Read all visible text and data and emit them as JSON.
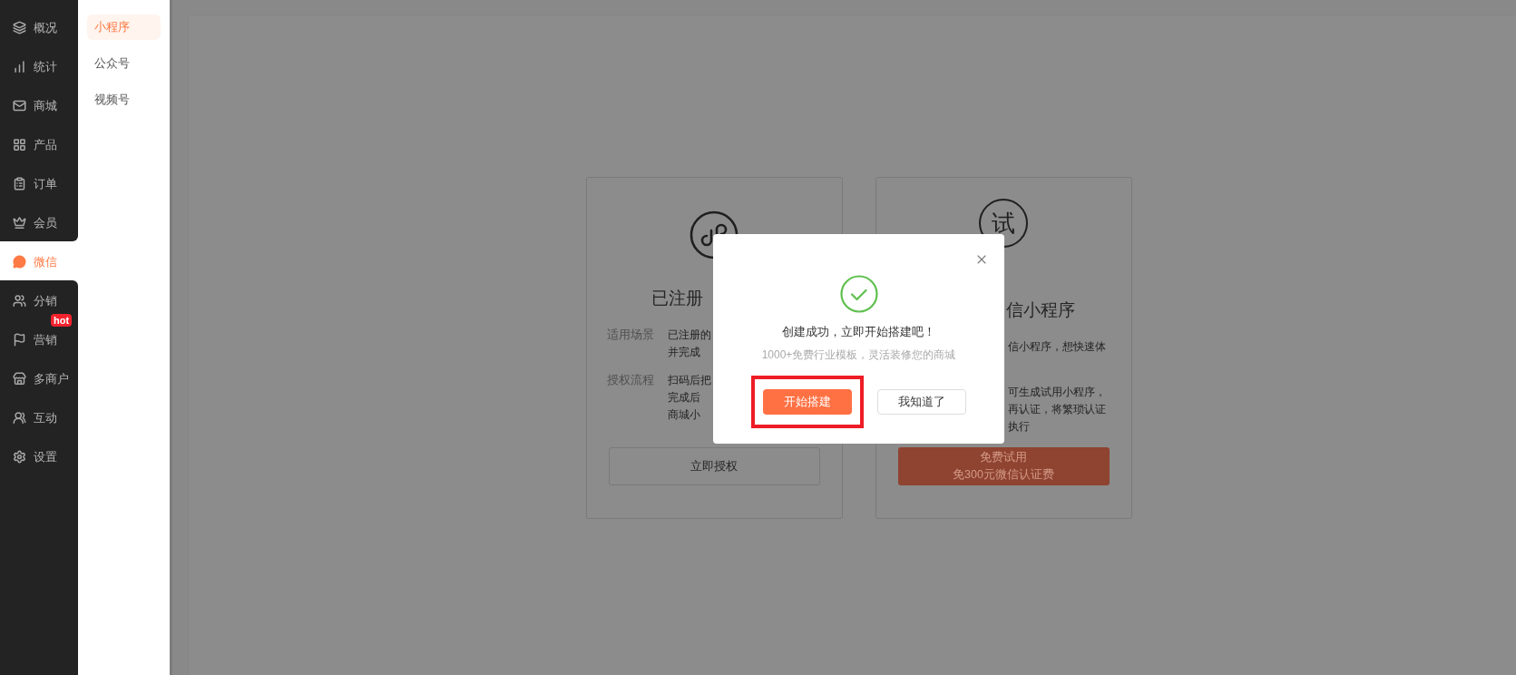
{
  "sidebar": {
    "items": [
      {
        "label": "概况",
        "selected": false
      },
      {
        "label": "统计",
        "selected": false
      },
      {
        "label": "商城",
        "selected": false
      },
      {
        "label": "产品",
        "selected": false
      },
      {
        "label": "订单",
        "selected": false
      },
      {
        "label": "会员",
        "selected": false
      },
      {
        "label": "微信",
        "selected": true
      },
      {
        "label": "分销",
        "selected": false
      },
      {
        "label": "营销",
        "selected": false,
        "badge": "hot"
      },
      {
        "label": "多商户",
        "selected": false
      },
      {
        "label": "互动",
        "selected": false
      },
      {
        "label": "设置",
        "selected": false
      }
    ]
  },
  "subnav": {
    "items": [
      {
        "label": "小程序",
        "selected": true
      },
      {
        "label": "公众号",
        "selected": false
      },
      {
        "label": "视频号",
        "selected": false
      }
    ]
  },
  "cards": [
    {
      "title": "已注册",
      "rows": [
        {
          "label": "适用场景",
          "lines": [
            "已注册的",
            "并完成"
          ]
        },
        {
          "label": "授权流程",
          "lines": [
            "扫码后把",
            "完成后",
            "商城小"
          ]
        }
      ],
      "button": {
        "kind": "outline",
        "lines": [
          "立即授权"
        ]
      }
    },
    {
      "icon_text": "试",
      "title": "信小程序",
      "rows": [
        {
          "lines": [
            "信小程序，想快速体"
          ]
        },
        {
          "lines": [
            "可生成试用小程序，",
            "再认证，将繁琐认证",
            "执行"
          ]
        }
      ],
      "button": {
        "kind": "primary",
        "lines": [
          "免费试用",
          "免300元微信认证费"
        ]
      }
    }
  ],
  "dialog": {
    "title": "创建成功，立即开始搭建吧！",
    "subtitle": "1000+免费行业模板，灵活装修您的商城",
    "buttons": [
      {
        "label": "开始搭建",
        "kind": "primary",
        "highlighted": true
      },
      {
        "label": "我知道了",
        "kind": "outline",
        "highlighted": false
      }
    ]
  }
}
